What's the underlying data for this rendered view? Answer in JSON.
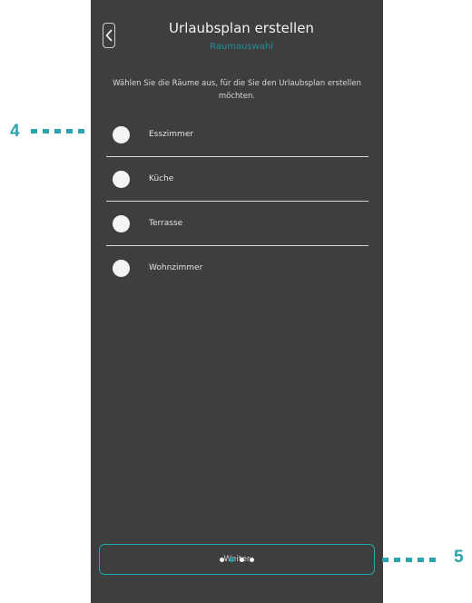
{
  "header": {
    "title": "Urlaubsplan erstellen",
    "subtitle": "Raumauswahl"
  },
  "instructions": "Wählen Sie die Räume aus, für die Sie den Urlaubsplan erstellen möchten.",
  "rooms": [
    {
      "label": "Esszimmer",
      "selected": false
    },
    {
      "label": "Küche",
      "selected": false
    },
    {
      "label": "Terrasse",
      "selected": false
    },
    {
      "label": "Wohnzimmer",
      "selected": false
    }
  ],
  "next_button": {
    "label": "Weiter"
  },
  "pagination": {
    "total": 4,
    "active_index": 1
  },
  "callouts": [
    {
      "label": "4"
    },
    {
      "label": "5"
    }
  ],
  "colors": {
    "accent": "#1e9aa5",
    "background": "#3e3e3e",
    "callout": "#2aa3ad"
  }
}
